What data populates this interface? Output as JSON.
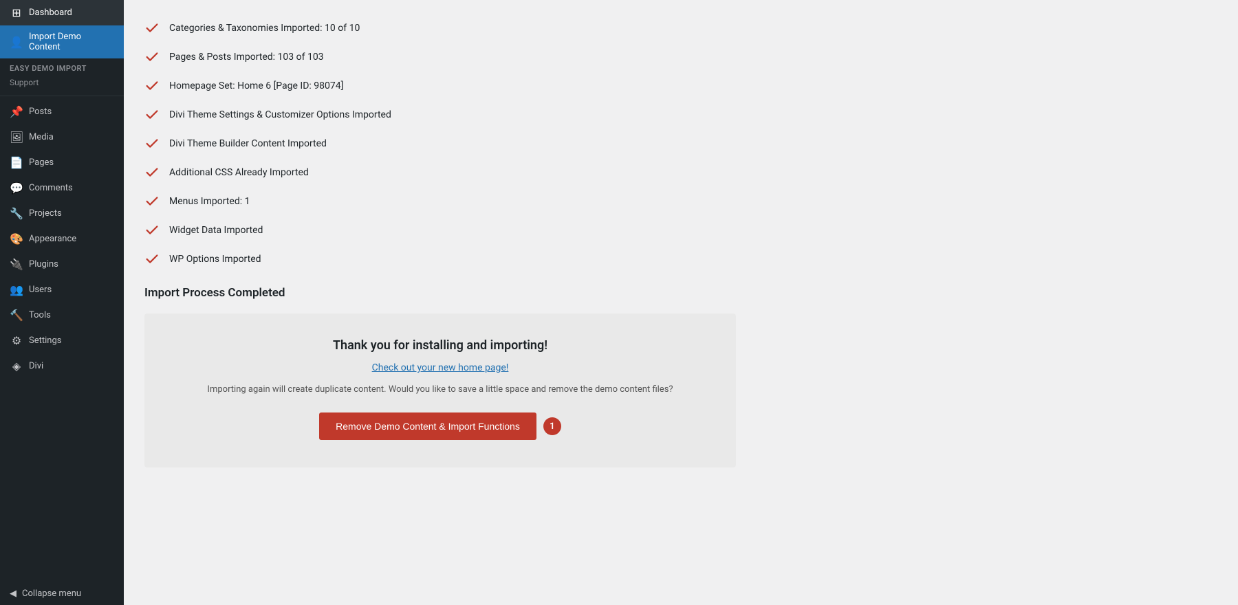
{
  "sidebar": {
    "dashboard_label": "Dashboard",
    "import_demo_content_label": "Import Demo Content",
    "easy_demo_import_label": "Easy Demo Import",
    "support_label": "Support",
    "posts_label": "Posts",
    "media_label": "Media",
    "pages_label": "Pages",
    "comments_label": "Comments",
    "projects_label": "Projects",
    "appearance_label": "Appearance",
    "plugins_label": "Plugins",
    "users_label": "Users",
    "tools_label": "Tools",
    "settings_label": "Settings",
    "divi_label": "Divi",
    "collapse_label": "Collapse menu"
  },
  "main": {
    "check_items": [
      "Categories & Taxonomies Imported: 10 of 10",
      "Pages & Posts Imported: 103 of 103",
      "Homepage Set: Home 6 [Page ID: 98074]",
      "Divi Theme Settings & Customizer Options Imported",
      "Divi Theme Builder Content Imported",
      "Additional CSS Already Imported",
      "Menus Imported: 1",
      "Widget Data Imported",
      "WP Options Imported"
    ],
    "import_complete_heading": "Import Process Completed",
    "thank_you_text": "Thank you for installing and importing!",
    "home_page_link": "Check out your new home page!",
    "duplicate_note": "Importing again will create duplicate content. Would you like to save a little space and remove the demo content files?",
    "remove_button_label": "Remove Demo Content & Import Functions",
    "badge_count": "1"
  }
}
